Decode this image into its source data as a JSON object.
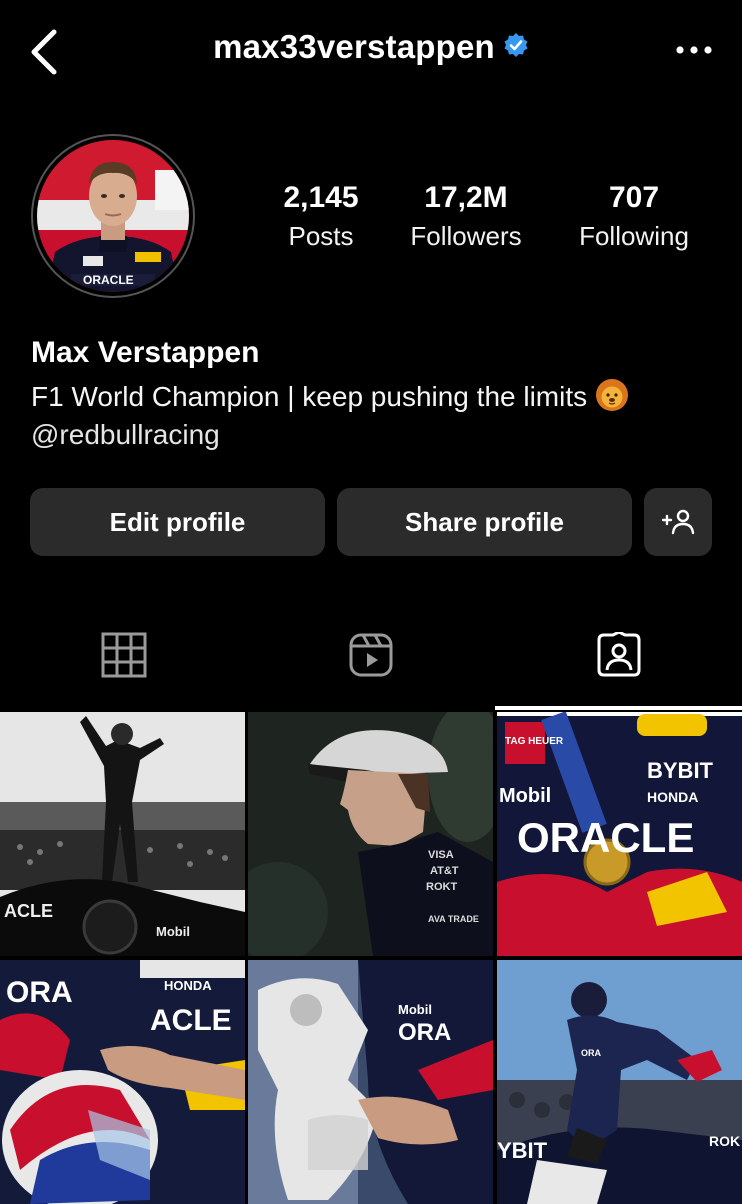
{
  "header": {
    "username": "max33verstappen",
    "back_icon": "chevron-left-icon",
    "verified_icon": "verified-badge-icon",
    "more_icon": "more-horizontal-icon"
  },
  "stats": {
    "posts": {
      "value": "2,145",
      "label": "Posts"
    },
    "followers": {
      "value": "17,2M",
      "label": "Followers"
    },
    "following": {
      "value": "707",
      "label": "Following"
    }
  },
  "bio": {
    "name": "Max Verstappen",
    "text": "F1 World Champion | keep pushing the limits",
    "emoji_icon": "lion-face-icon",
    "link": "@redbullracing"
  },
  "actions": {
    "edit_label": "Edit profile",
    "share_label": "Share profile",
    "add_icon": "add-person-icon"
  },
  "tabs": [
    {
      "icon": "grid-icon",
      "active": false
    },
    {
      "icon": "reels-icon",
      "active": false
    },
    {
      "icon": "tagged-icon",
      "active": true
    }
  ],
  "posts_grid": [
    {
      "icon": "photo-thumbnail",
      "text": [
        "ACLE",
        "Mobil"
      ]
    },
    {
      "icon": "photo-thumbnail",
      "text": [
        "VISA",
        "AT&T",
        "ROKT",
        "AVA TRADE"
      ]
    },
    {
      "icon": "photo-thumbnail",
      "text": [
        "TAG HEUER",
        "BYBIT",
        "HONDA",
        "Mobil",
        "ORACLE"
      ]
    },
    {
      "icon": "photo-thumbnail",
      "text": [
        "HONDA",
        "ACLE",
        "ORA"
      ]
    },
    {
      "icon": "photo-thumbnail",
      "text": [
        "Mobil",
        "ORA"
      ]
    },
    {
      "icon": "photo-thumbnail",
      "text": [
        "ORA",
        "YBIT",
        "ROK"
      ]
    }
  ],
  "colors": {
    "background": "#000000",
    "button": "#2b2b2b",
    "verified": "#3897f0"
  }
}
